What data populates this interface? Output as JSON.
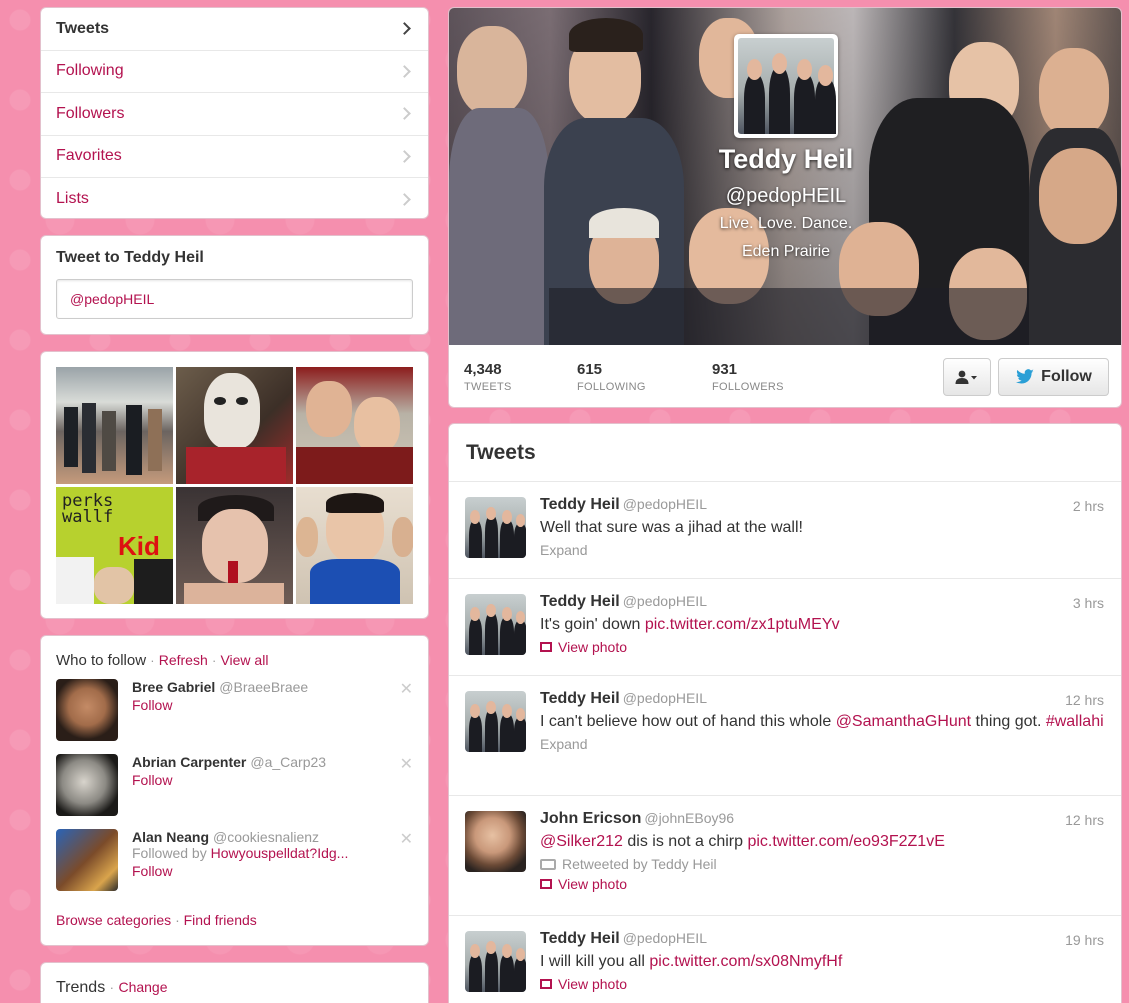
{
  "nav": {
    "items": [
      {
        "label": "Tweets"
      },
      {
        "label": "Following"
      },
      {
        "label": "Followers"
      },
      {
        "label": "Favorites"
      },
      {
        "label": "Lists"
      }
    ]
  },
  "tweet_box": {
    "title": "Tweet to Teddy Heil",
    "value": "@pedopHEIL"
  },
  "who_to_follow": {
    "title": "Who to follow",
    "sep": "·",
    "refresh": "Refresh",
    "view_all": "View all",
    "suggestions": [
      {
        "name": "Bree Gabriel",
        "handle": "@BraeeBraee",
        "follow": "Follow",
        "followed_by_prefix": "",
        "followed_by_link": ""
      },
      {
        "name": "Abrian Carpenter",
        "handle": "@a_Carp23",
        "follow": "Follow",
        "followed_by_prefix": "",
        "followed_by_link": ""
      },
      {
        "name": "Alan Neang",
        "handle": "@cookiesnalienz",
        "follow": "Follow",
        "followed_by_prefix": "Followed by",
        "followed_by_link": "Howyouspelldat?Idg..."
      }
    ],
    "browse": "Browse categories",
    "find_friends": "Find friends",
    "close_glyph": "✕"
  },
  "trends": {
    "title": "Trends",
    "change": "Change"
  },
  "profile": {
    "name": "Teddy Heil",
    "handle": "@pedopHEIL",
    "bio": "Live. Love. Dance.",
    "location": "Eden Prairie",
    "stats": [
      {
        "value": "4,348",
        "label": "TWEETS"
      },
      {
        "value": "615",
        "label": "FOLLOWING"
      },
      {
        "value": "931",
        "label": "FOLLOWERS"
      }
    ],
    "follow_label": "Follow",
    "user_menu_icon": "person-dropdown-icon"
  },
  "tweets": {
    "title": "Tweets",
    "items": [
      {
        "name": "Teddy Heil",
        "handle": "@pedopHEIL",
        "time": "2 hrs",
        "text": "Well that sure was a jihad at the wall!",
        "extra": "Expand"
      },
      {
        "name": "Teddy Heil",
        "handle": "@pedopHEIL",
        "time": "3 hrs",
        "text_prefix": "It's goin' down ",
        "link": "pic.twitter.com/zx1ptuMEYv",
        "extra": "View photo"
      },
      {
        "name": "Teddy Heil",
        "handle": "@pedopHEIL",
        "time": "12 hrs",
        "text_prefix": "I can't believe how out of hand this whole ",
        "mention": "@SamanthaGHunt",
        "text_mid": " thing got. ",
        "hashtag": "#wallahi",
        "extra": "Expand"
      },
      {
        "name": "John Ericson",
        "handle": "@johnEBoy96",
        "time": "12 hrs",
        "mention": "@Silker212",
        "text_mid": " dis is not a chirp ",
        "link": "pic.twitter.com/eo93F2Z1vE",
        "retweeted": "Retweeted by Teddy Heil",
        "extra": "View photo"
      },
      {
        "name": "Teddy Heil",
        "handle": "@pedopHEIL",
        "time": "19 hrs",
        "text_prefix": "I will kill you all ",
        "link": "pic.twitter.com/sx08NmyfHf",
        "extra": "View photo"
      }
    ]
  },
  "colors": {
    "background": "#f58fae",
    "link": "#b3124f",
    "follow_blue": "#2a9fd6"
  }
}
